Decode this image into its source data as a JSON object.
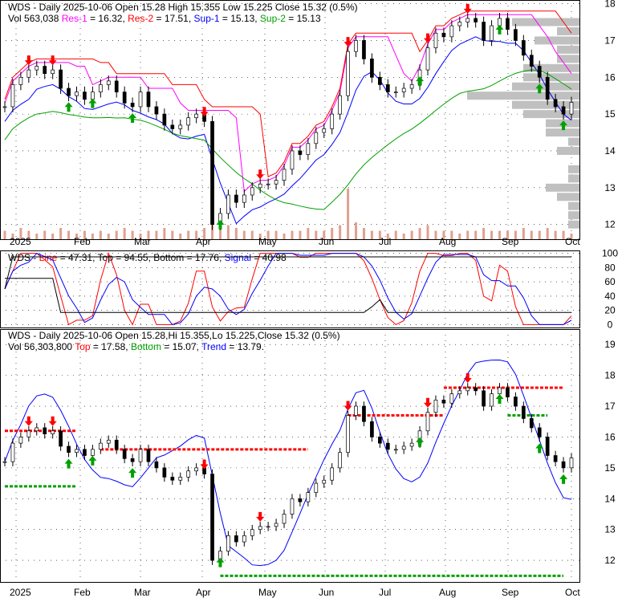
{
  "chart_data": [
    {
      "type": "candlestick",
      "title": "WDS - Daily 2025-10-06 Open 15.28  High 15.355  Low 15.225  Close 15.32 (0.5%)",
      "header": {
        "symbol": "WDS",
        "sep": " - ",
        "desc": "Daily 2025-10-06 Open 15.28  High 15.355  Low 15.225  Close 15.32 (0.5%)",
        "vol": "Vol 563,038 ",
        "res1": "Res-1",
        "res1v": " = 16.32, ",
        "res2": "Res-2",
        "res2v": " = 17.51, ",
        "sup1": "Sup-1",
        "sup1v": " = 15.13, ",
        "sup2": "Sup-2",
        "sup2v": " = 15.13"
      },
      "ylim": [
        11.6,
        18.1
      ],
      "yticks": [
        "12",
        "13",
        "14",
        "15",
        "16",
        "17",
        "18"
      ],
      "months": [
        "2025",
        "Feb",
        "Mar",
        "Apr",
        "May",
        "Jun",
        "Jul",
        "Aug",
        "Sep",
        "Oct"
      ],
      "closes": [
        15.2,
        15.8,
        16.0,
        16.2,
        16.3,
        16.1,
        16.2,
        15.7,
        15.5,
        15.6,
        15.4,
        15.6,
        15.8,
        15.9,
        15.6,
        15.3,
        15.2,
        15.6,
        15.2,
        15.0,
        14.7,
        14.6,
        14.7,
        14.9,
        15.0,
        14.8,
        12.0,
        12.3,
        12.8,
        12.6,
        12.8,
        13.0,
        13.1,
        13.1,
        13.2,
        13.5,
        14.0,
        13.9,
        14.2,
        14.5,
        14.6,
        15.0,
        15.5,
        16.7,
        17.0,
        16.5,
        16.0,
        15.8,
        15.6,
        15.6,
        15.7,
        15.8,
        16.2,
        16.8,
        17.2,
        17.1,
        17.4,
        17.5,
        17.6,
        17.5,
        17.0,
        17.4,
        17.6,
        17.3,
        17.0,
        16.6,
        16.3,
        16.0,
        15.4,
        15.2,
        15.0,
        15.32
      ],
      "volumes": [
        3,
        2,
        4,
        3,
        2,
        3,
        2,
        4,
        3,
        2,
        3,
        2,
        3,
        2,
        3,
        4,
        3,
        2,
        3,
        3,
        4,
        3,
        2,
        3,
        3,
        4,
        9,
        7,
        5,
        4,
        3,
        3,
        2,
        3,
        3,
        2,
        3,
        3,
        4,
        3,
        3,
        4,
        5,
        18,
        6,
        4,
        3,
        3,
        2,
        3,
        2,
        3,
        4,
        5,
        3,
        3,
        3,
        2,
        3,
        3,
        4,
        3,
        3,
        3,
        3,
        4,
        3,
        3,
        4,
        3,
        3,
        2
      ]
    },
    {
      "type": "line",
      "header": {
        "symbol": "WDS",
        "sep": " - ",
        "line": "Line",
        "linev": " = 47.31, Top = 94.55, Bottom = 17.76, ",
        "signal": "Signal",
        "signalv": " = 40.98"
      },
      "ylim": [
        0,
        100
      ],
      "yticks": [
        "0",
        "20",
        "40",
        "60",
        "80",
        "100"
      ]
    },
    {
      "type": "candlestick",
      "header": {
        "symbol": "WDS",
        "desc": " - Daily 2025-10-06 Open 15.28,Hi 15.355,Lo 15.225,Close 15.32 (0.5%)",
        "vol": "Vol 56,303,800 ",
        "top": "Top",
        "topv": " = 17.58, ",
        "bottom": "Bottom",
        "bottomv": " = 15.07, ",
        "trend": "Trend",
        "trendv": " = 13.79."
      },
      "ylim": [
        11.3,
        19.5
      ],
      "yticks": [
        "12",
        "13",
        "14",
        "15",
        "16",
        "17",
        "18",
        "19"
      ]
    }
  ],
  "colors": {
    "up": "#00a000",
    "down": "#e00000",
    "blue": "#0000ff",
    "magenta": "#ff00ff",
    "green": "#00a000",
    "red": "#ff0000"
  }
}
